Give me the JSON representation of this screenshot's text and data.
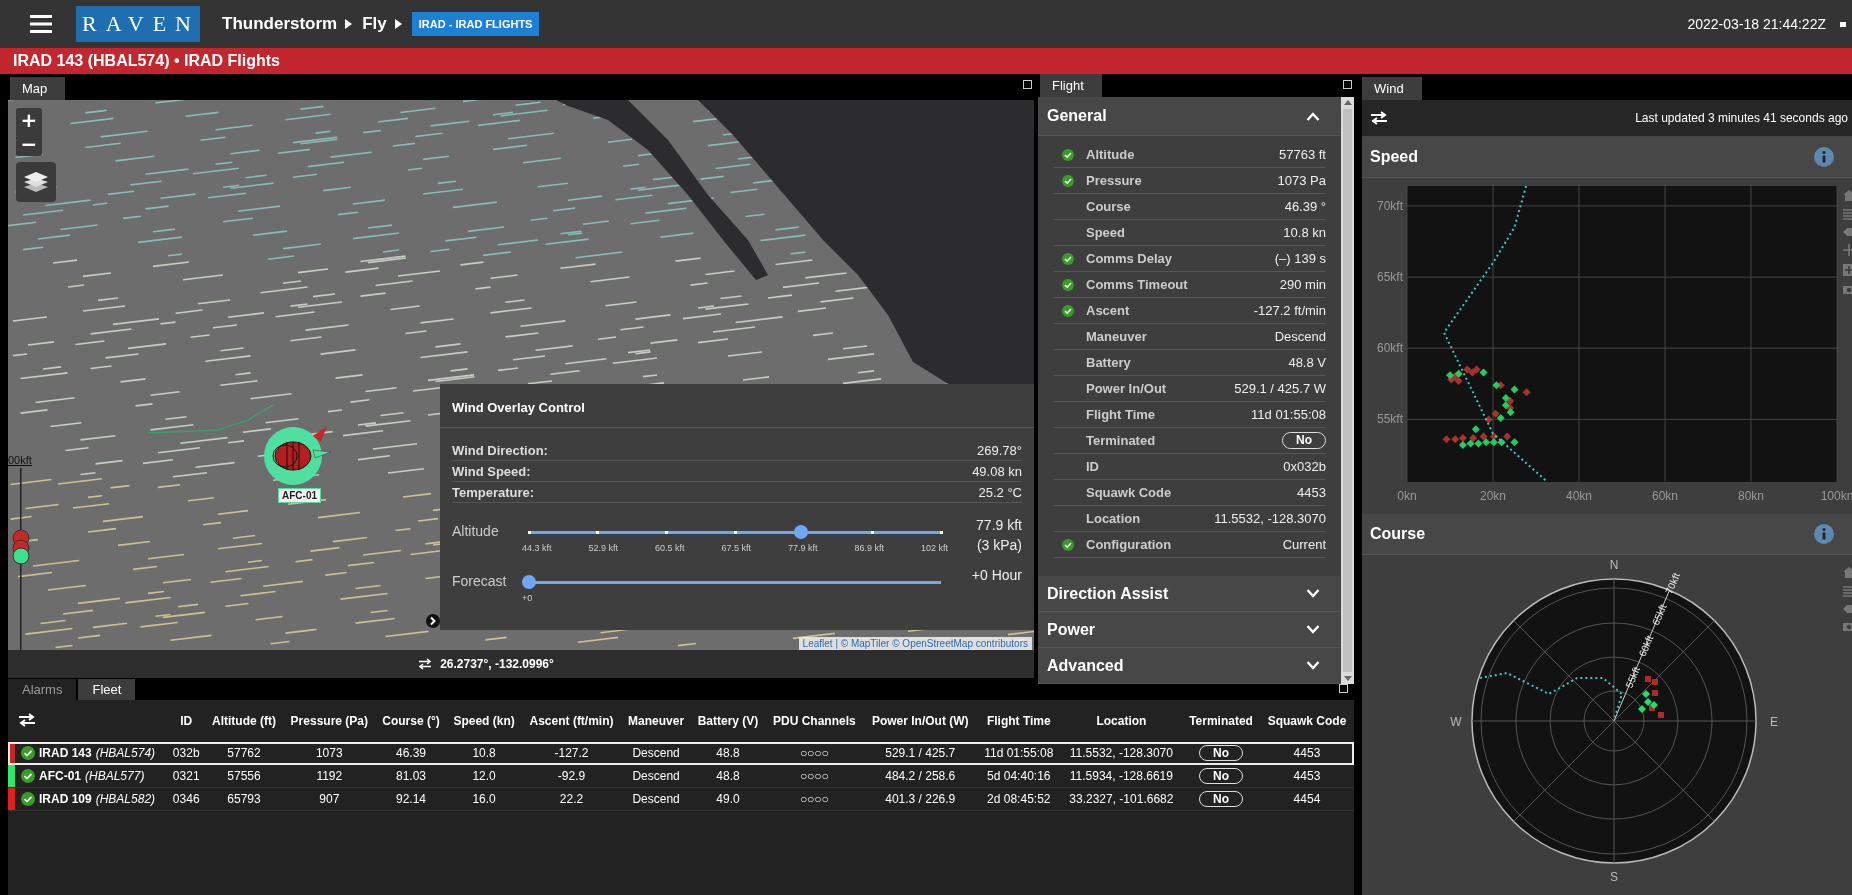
{
  "header": {
    "logo": "RAVEN",
    "breadcrumb": [
      "Thunderstorm",
      "Fly"
    ],
    "badge": "IRAD - IRAD FLIGHTS",
    "time": "2022-03-18 21:44:22Z"
  },
  "title": "IRAD 143 (HBAL574) • IRAD Flights",
  "map": {
    "tab": "Map",
    "zoom_in": "+",
    "zoom_out": "−",
    "altitude_label": "00kft",
    "marker_label": "AFC-01",
    "overlay": {
      "title": "Wind Overlay Control",
      "readings": [
        {
          "label": "Wind Direction:",
          "value": "269.78°"
        },
        {
          "label": "Wind Speed:",
          "value": "49.08 kn"
        },
        {
          "label": "Temperature:",
          "value": "25.2 °C"
        }
      ],
      "altitude": {
        "label": "Altitude",
        "ticks": [
          "44.3 kft",
          "52.9 kft",
          "60.5 kft",
          "67.5 kft",
          "77.9 kft",
          "86.9 kft",
          "102 kft"
        ],
        "level": 0.66,
        "value": "77.9 kft",
        "pressure": "(3 kPa)"
      },
      "forecast": {
        "label": "Forecast",
        "ticks": [
          "+0"
        ],
        "level": 0,
        "value": "+0 Hour"
      }
    },
    "attribution": "Leaflet | © MapTiler © OpenStreetMap contributors",
    "coordinates": "26.2737°, -132.0996°"
  },
  "flight": {
    "tab": "Flight",
    "sections": [
      {
        "title": "General",
        "expanded": true,
        "rows": [
          {
            "label": "Altitude",
            "value": "57763 ft",
            "ok": true,
            "kind": "text"
          },
          {
            "label": "Pressure",
            "value": "1073 Pa",
            "ok": true,
            "kind": "text"
          },
          {
            "label": "Course",
            "value": "46.39 °",
            "ok": false,
            "kind": "text"
          },
          {
            "label": "Speed",
            "value": "10.8 kn",
            "ok": false,
            "kind": "text"
          },
          {
            "label": "Comms Delay",
            "value": "(–) 139 s",
            "ok": true,
            "kind": "text"
          },
          {
            "label": "Comms Timeout",
            "value": "290 min",
            "ok": true,
            "kind": "text"
          },
          {
            "label": "Ascent",
            "value": "-127.2 ft/min",
            "ok": true,
            "kind": "text"
          },
          {
            "label": "Maneuver",
            "value": "Descend",
            "ok": false,
            "kind": "text"
          },
          {
            "label": "Battery",
            "value": "48.8 V",
            "ok": false,
            "kind": "text"
          },
          {
            "label": "Power In/Out",
            "value": "529.1 / 425.7 W",
            "ok": false,
            "kind": "text"
          },
          {
            "label": "Flight Time",
            "value": "11d 01:55:08",
            "ok": false,
            "kind": "text"
          },
          {
            "label": "Terminated",
            "value": "No",
            "ok": false,
            "kind": "pill"
          },
          {
            "label": "ID",
            "value": "0x032b",
            "ok": false,
            "kind": "text"
          },
          {
            "label": "Squawk Code",
            "value": "4453",
            "ok": false,
            "kind": "text"
          },
          {
            "label": "Location",
            "value": "11.5532, -128.3070",
            "ok": false,
            "kind": "text"
          },
          {
            "label": "Configuration",
            "value": "Current",
            "ok": true,
            "kind": "text"
          }
        ]
      },
      {
        "title": "Direction Assist",
        "expanded": false
      },
      {
        "title": "Power",
        "expanded": false
      },
      {
        "title": "Advanced",
        "expanded": false
      }
    ]
  },
  "wind": {
    "tab": "Wind",
    "updated": "Last updated 3 minutes 41 seconds ago",
    "speed": {
      "title": "Speed",
      "chart_data": {
        "type": "scatter",
        "grid": true,
        "xlim": [
          0,
          100
        ],
        "ylim": [
          50.6,
          71.4
        ],
        "xticks": [
          {
            "value": 0,
            "label": "0kn"
          },
          {
            "value": 20,
            "label": "20kn"
          },
          {
            "value": 40,
            "label": "40kn"
          },
          {
            "value": 60,
            "label": "60kn"
          },
          {
            "value": 80,
            "label": "80kn"
          },
          {
            "value": 100,
            "label": "100kn"
          }
        ],
        "yticks": [
          {
            "value": 55,
            "label": "55kft"
          },
          {
            "value": 60,
            "label": "60kft"
          },
          {
            "value": 65,
            "label": "65kft"
          },
          {
            "value": 70,
            "label": "70kft"
          }
        ],
        "series": [
          {
            "color": "#a8322f",
            "x": [
              10.3,
              11.1,
              14.0,
              15.2,
              16.2,
              12.0,
              21.8,
              24.0,
              24.0,
              27.8,
              19.0,
              20.6,
              9.2,
              11.2,
              13.0,
              15.4,
              17.8,
              20.2,
              23.3
            ],
            "values": [
              57.8,
              58.0,
              58.5,
              58.3,
              58.5,
              57.7,
              57.4,
              56.3,
              55.8,
              56.9,
              55.0,
              55.4,
              53.6,
              53.6,
              53.7,
              53.7,
              53.8,
              53.8,
              53.8
            ]
          },
          {
            "color": "#22cc5e",
            "x": [
              10.0,
              12.0,
              17.8,
              20.8,
              25.0,
              23.0,
              23.0,
              24.1,
              21.8,
              16.0,
              13.0,
              14.8,
              16.6,
              18.4,
              20.2,
              22.0,
              25.0
            ],
            "values": [
              58.1,
              58.2,
              58.3,
              57.4,
              57.1,
              56.5,
              56.0,
              55.5,
              55.1,
              54.3,
              53.2,
              53.3,
              53.3,
              53.4,
              53.4,
              53.4,
              53.4
            ]
          },
          {
            "color": "#3cc8c8",
            "type": "line",
            "line_style": "dotted",
            "x": [
              27.7,
              25.0,
              20.0,
              8.6,
              20.0,
              32.3
            ],
            "values": [
              71.4,
              68.5,
              66.0,
              61.1,
              54.0,
              50.7
            ]
          }
        ]
      }
    },
    "course": {
      "title": "Course",
      "compass": [
        "N",
        "E",
        "S",
        "W"
      ],
      "rings": [
        "55kft",
        "60kft",
        "65kft",
        "70kft"
      ]
    }
  },
  "fleet": {
    "tabs": [
      {
        "label": "Alarms",
        "selected": false
      },
      {
        "label": "Fleet",
        "selected": true
      }
    ],
    "columns": [
      {
        "label": "ID",
        "kind": "text"
      },
      {
        "label": "Altitude (ft)",
        "kind": "text"
      },
      {
        "label": "Pressure (Pa)",
        "kind": "text"
      },
      {
        "label": "Course (°)",
        "kind": "text"
      },
      {
        "label": "Speed (kn)",
        "kind": "text"
      },
      {
        "label": "Ascent (ft/min)",
        "kind": "text"
      },
      {
        "label": "Maneuver",
        "kind": "text"
      },
      {
        "label": "Battery (V)",
        "kind": "text"
      },
      {
        "label": "PDU Channels",
        "kind": "text"
      },
      {
        "label": "Power In/Out (W)",
        "kind": "text"
      },
      {
        "label": "Flight Time",
        "kind": "text"
      },
      {
        "label": "Location",
        "kind": "text"
      },
      {
        "label": "Terminated",
        "kind": "pill"
      },
      {
        "label": "Squawk Code",
        "kind": "text"
      }
    ],
    "rows": [
      {
        "name": "IRAD 143",
        "callsign": "(HBAL574)",
        "color": "#c62828",
        "selected": true,
        "ok": true,
        "cells": [
          "032b",
          "57762",
          "1073",
          "46.39",
          "10.8",
          "-127.2",
          "Descend",
          "48.8",
          "○○○○",
          "529.1 / 425.7",
          "11d 01:55:08",
          "11.5532, -128.3070",
          "No",
          "4453"
        ]
      },
      {
        "name": "AFC-01",
        "callsign": "(HBAL577)",
        "color": "#2ee86c",
        "selected": false,
        "ok": true,
        "cells": [
          "0321",
          "57556",
          "1192",
          "81.03",
          "12.0",
          "-92.9",
          "Descend",
          "48.8",
          "○○○○",
          "484.2 / 258.6",
          "5d 04:40:16",
          "11.5934, -128.6619",
          "No",
          "4453"
        ]
      },
      {
        "name": "IRAD 109",
        "callsign": "(HBAL582)",
        "color": "#e02020",
        "selected": false,
        "ok": true,
        "cells": [
          "0346",
          "65793",
          "907",
          "92.14",
          "16.0",
          "22.2",
          "Descend",
          "49.0",
          "○○○○",
          "401.3 / 226.9",
          "2d 08:45:52",
          "33.2327, -101.6682",
          "No",
          "4454"
        ]
      }
    ]
  }
}
